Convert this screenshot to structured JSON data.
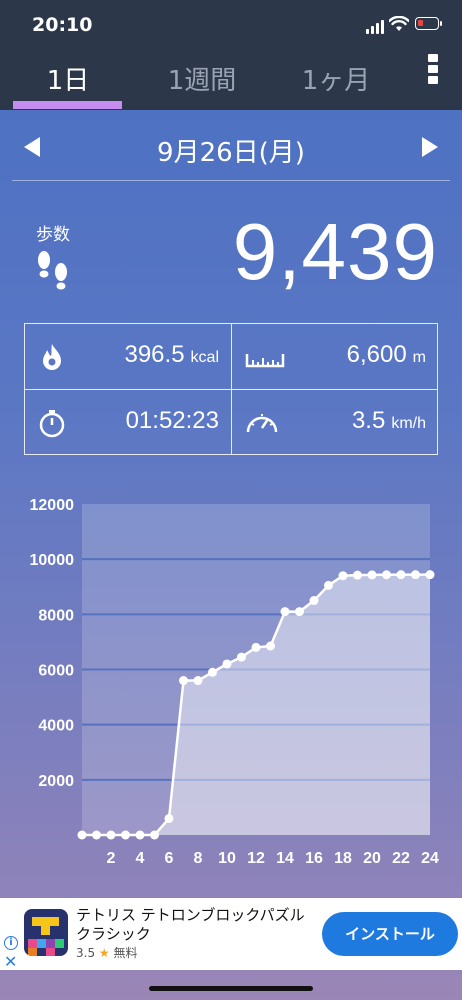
{
  "status_bar": {
    "time": "20:10"
  },
  "tabs": [
    {
      "label": "1日",
      "active": true
    },
    {
      "label": "1週間",
      "active": false
    },
    {
      "label": "1ヶ月",
      "active": false
    }
  ],
  "date_nav": {
    "date": "9月26日(月)"
  },
  "steps": {
    "label": "歩数",
    "value": "9,439"
  },
  "stats": {
    "calories": {
      "value": "396.5",
      "unit": "kcal"
    },
    "distance": {
      "value": "6,600",
      "unit": "m"
    },
    "duration": {
      "value": "01:52:23"
    },
    "speed": {
      "value": "3.5",
      "unit": "km/h"
    }
  },
  "colors": {
    "header_bg": "#2c3849",
    "tab_underline": "#c58df0",
    "install_button": "#1f7ae0"
  },
  "chart_data": {
    "type": "area",
    "title": "",
    "xlabel": "",
    "ylabel": "",
    "x": [
      0,
      1,
      2,
      3,
      4,
      5,
      6,
      7,
      8,
      9,
      10,
      11,
      12,
      13,
      14,
      15,
      16,
      17,
      18,
      19,
      20,
      21,
      22,
      23,
      24
    ],
    "values": [
      0,
      0,
      0,
      0,
      0,
      0,
      600,
      5600,
      5600,
      5900,
      6200,
      6450,
      6800,
      6850,
      8100,
      8100,
      8500,
      9050,
      9400,
      9420,
      9430,
      9435,
      9438,
      9439,
      9439
    ],
    "x_tick_labels": [
      "2",
      "4",
      "6",
      "8",
      "10",
      "12",
      "14",
      "16",
      "18",
      "20",
      "22",
      "24"
    ],
    "x_ticks": [
      2,
      4,
      6,
      8,
      10,
      12,
      14,
      16,
      18,
      20,
      22,
      24
    ],
    "y_tick_labels": [
      "12000",
      "10000",
      "8000",
      "6000",
      "4000",
      "2000"
    ],
    "y_ticks": [
      12000,
      10000,
      8000,
      6000,
      4000,
      2000
    ],
    "ylim": [
      0,
      12000
    ],
    "xlim": [
      0,
      24
    ],
    "grid": true
  },
  "ad": {
    "info_icon": "info-icon",
    "close": "✕",
    "title": "テトリス テトロンブロックパズル クラシック",
    "rating": "3.5",
    "price": "無料",
    "button": "インストール"
  }
}
